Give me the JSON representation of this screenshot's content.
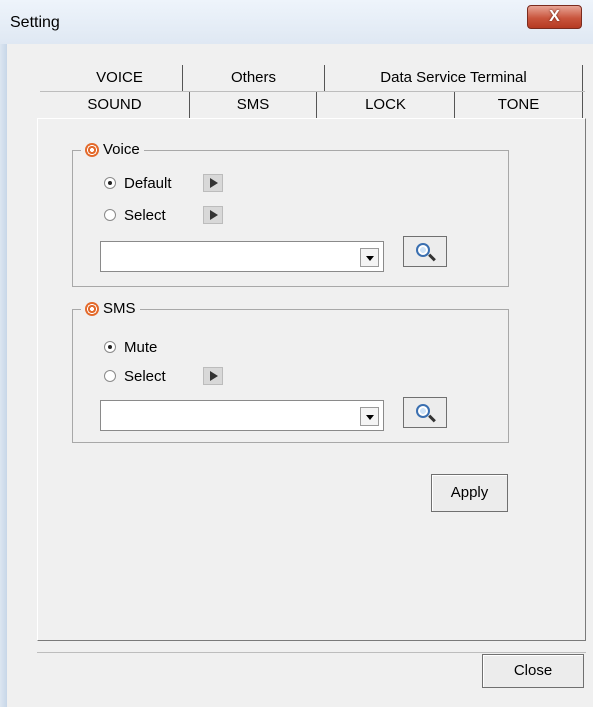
{
  "window": {
    "title": "Setting",
    "close_glyph": "X"
  },
  "tabs": {
    "top_row": [
      "VOICE",
      "Others",
      "Data Service Terminal"
    ],
    "bottom_row": [
      "SOUND",
      "SMS",
      "LOCK",
      "TONE"
    ]
  },
  "voice_group": {
    "label": "Voice",
    "options": [
      {
        "label": "Default",
        "checked": true
      },
      {
        "label": "Select",
        "checked": false
      }
    ],
    "combo_value": ""
  },
  "sms_group": {
    "label": "SMS",
    "options": [
      {
        "label": "Mute",
        "checked": true
      },
      {
        "label": "Select",
        "checked": false
      }
    ],
    "combo_value": ""
  },
  "buttons": {
    "apply": "Apply",
    "close": "Close"
  },
  "icons": {
    "group": "target-icon",
    "play": "play-icon",
    "browse": "magnifier-icon",
    "dropdown": "chevron-down-icon"
  }
}
